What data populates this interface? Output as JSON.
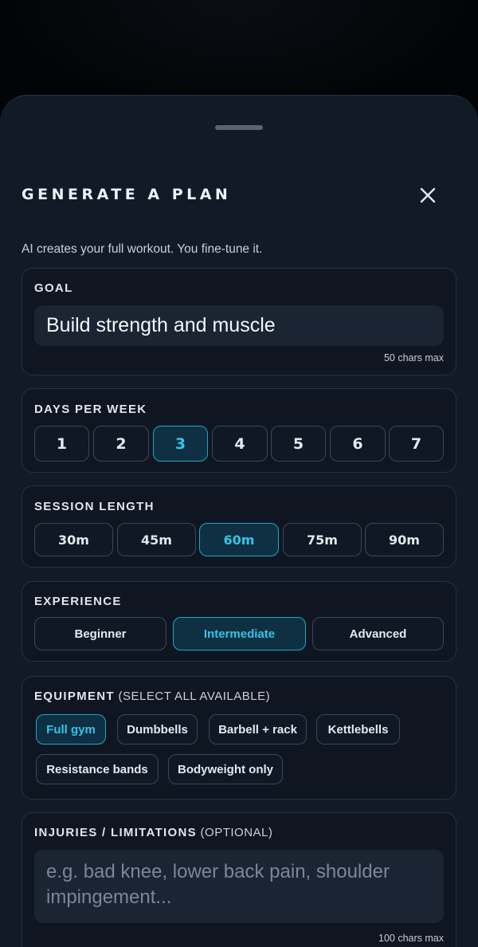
{
  "sheet": {
    "title": "GENERATE A PLAN",
    "subtitle": "AI creates your full workout. You fine-tune it."
  },
  "goal": {
    "label": "GOAL",
    "value": "Build strength and muscle",
    "max_note": "50 chars max"
  },
  "days": {
    "label": "DAYS PER WEEK",
    "options": [
      "1",
      "2",
      "3",
      "4",
      "5",
      "6",
      "7"
    ],
    "selected": "3"
  },
  "session": {
    "label": "SESSION LENGTH",
    "options": [
      "30m",
      "45m",
      "60m",
      "75m",
      "90m"
    ],
    "selected": "60m"
  },
  "experience": {
    "label": "EXPERIENCE",
    "options": [
      "Beginner",
      "Intermediate",
      "Advanced"
    ],
    "selected": "Intermediate"
  },
  "equipment": {
    "label": "EQUIPMENT",
    "label_sub": " (SELECT ALL AVAILABLE)",
    "options": [
      "Full gym",
      "Dumbbells",
      "Barbell + rack",
      "Kettlebells",
      "Resistance bands",
      "Bodyweight only"
    ],
    "selected": [
      "Full gym"
    ]
  },
  "injuries": {
    "label": "INJURIES / LIMITATIONS",
    "label_sub": " (OPTIONAL)",
    "placeholder": "e.g. bad knee, lower back pain, shoulder impingement...",
    "max_note": "100 chars max"
  },
  "colors": {
    "accent": "#1ea6c6",
    "sheet_bg": "#121a28",
    "card_bg": "#0f1622"
  },
  "icons": {
    "close": "close-icon",
    "grabber": "drag-handle"
  }
}
